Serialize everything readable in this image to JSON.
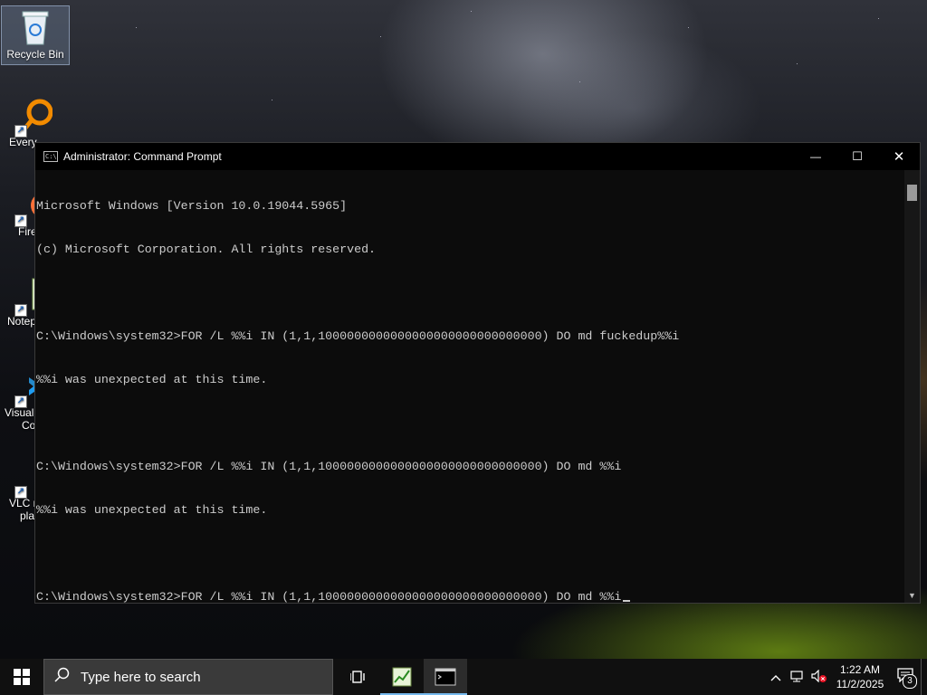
{
  "desktop": {
    "icons": [
      {
        "label": "Recycle Bin"
      },
      {
        "label": "Every"
      },
      {
        "label": "Fire"
      },
      {
        "label": "Notep"
      },
      {
        "label": "Visual",
        "label2": "Co"
      },
      {
        "label": "VLC r",
        "label2": "pla"
      }
    ]
  },
  "window": {
    "title": "Administrator: Command Prompt",
    "minimize": "—",
    "maximize": "☐",
    "close": "✕",
    "console_lines": [
      "Microsoft Windows [Version 10.0.19044.5965]",
      "(c) Microsoft Corporation. All rights reserved.",
      "",
      "C:\\Windows\\system32>FOR /L %%i IN (1,1,1000000000000000000000000000000) DO md fuckedup%%i",
      "%%i was unexpected at this time.",
      "",
      "C:\\Windows\\system32>FOR /L %%i IN (1,1,1000000000000000000000000000000) DO md %%i",
      "%%i was unexpected at this time.",
      "",
      "C:\\Windows\\system32>FOR /L %%i IN (1,1,1000000000000000000000000000000) DO md %%i"
    ]
  },
  "taskbar": {
    "search_placeholder": "Type here to search",
    "time": "1:22 AM",
    "date": "11/2/2025",
    "notification_count": "3"
  }
}
